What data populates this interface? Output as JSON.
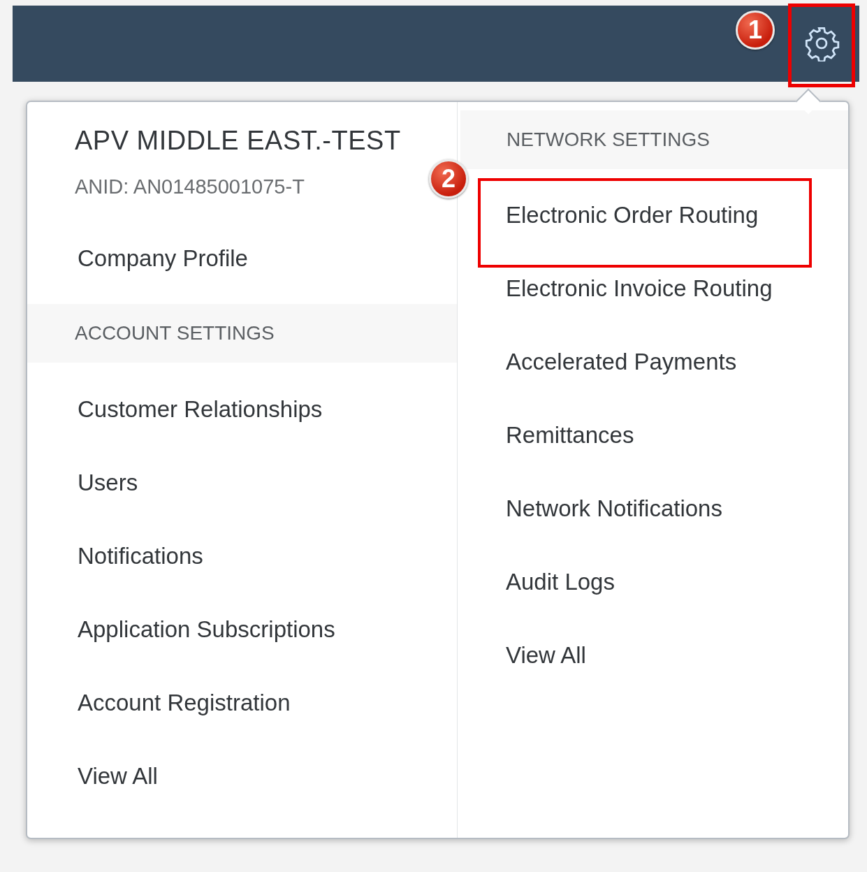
{
  "header": {
    "settings_button": {
      "highlighted": true,
      "step": "1"
    }
  },
  "menu": {
    "account": {
      "company_name": "APV MIDDLE EAST.-TEST",
      "anid": "ANID: AN01485001075-T",
      "profile_link": "Company Profile",
      "section": "ACCOUNT SETTINGS",
      "items": [
        {
          "label": "Customer Relationships",
          "highlighted": false
        },
        {
          "label": "Users",
          "highlighted": false
        },
        {
          "label": "Notifications",
          "highlighted": false
        },
        {
          "label": "Application Subscriptions",
          "highlighted": false
        },
        {
          "label": "Account Registration",
          "highlighted": false
        },
        {
          "label": "View All",
          "highlighted": false
        }
      ]
    },
    "network": {
      "section": "NETWORK SETTINGS",
      "items": [
        {
          "label": "Electronic Order Routing",
          "highlighted": true,
          "step": "2"
        },
        {
          "label": "Electronic Invoice Routing",
          "highlighted": false
        },
        {
          "label": "Accelerated Payments",
          "highlighted": false
        },
        {
          "label": "Remittances",
          "highlighted": false
        },
        {
          "label": "Network Notifications",
          "highlighted": false
        },
        {
          "label": "Audit Logs",
          "highlighted": false
        },
        {
          "label": "View All",
          "highlighted": false
        }
      ]
    }
  }
}
